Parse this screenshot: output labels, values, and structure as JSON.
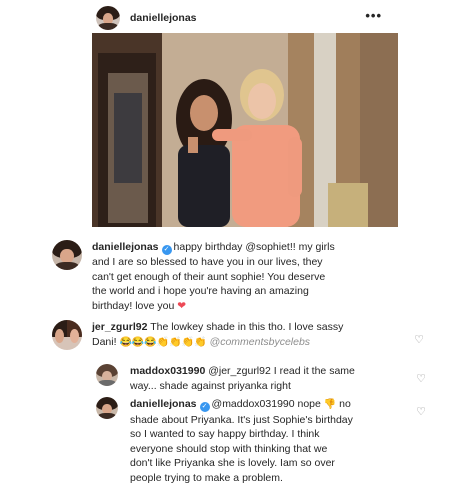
{
  "post": {
    "username": "daniellejonas",
    "more_label": "•••",
    "photo_alt": "daniellejonas post photo"
  },
  "comments": [
    {
      "username": "daniellejonas",
      "verified": true,
      "lines": [
        "happy birthday @sophiet!! my girls",
        "and I are so blessed to have you in our lives, they",
        "can't get enough of their aunt sophie! You deserve",
        "the world and i hope you're having an amazing",
        "birthday! love you"
      ],
      "end_icon": "heart-icon"
    },
    {
      "username": "jer_zgurl92",
      "lines": [
        "The lowkey shade in this tho. I love sassy",
        "Dani!"
      ],
      "emojis": "😂😂😂👏👏👏👏",
      "watermark": "@commentsbycelebs",
      "like_icon": "♡"
    }
  ],
  "replies": [
    {
      "username": "maddox031990",
      "lines": [
        "@jer_zgurl92 I read it the same",
        "way... shade against priyanka right"
      ],
      "like_icon": "♡"
    },
    {
      "username": "daniellejonas",
      "verified": true,
      "lines": [
        "@maddox031990 nope",
        "no",
        "shade about Priyanka. It's just Sophie's birthday",
        "so I wanted to say happy birthday. I think",
        "everyone should stop with thinking that we",
        "don't like Priyanka she is lovely. Iam so over",
        "people trying to make a problem."
      ],
      "like_icon": "♡"
    }
  ],
  "colors": {
    "verified": "#3897f0",
    "heart": "#ed4956",
    "muted": "#8e8e8e",
    "text": "#262626"
  }
}
